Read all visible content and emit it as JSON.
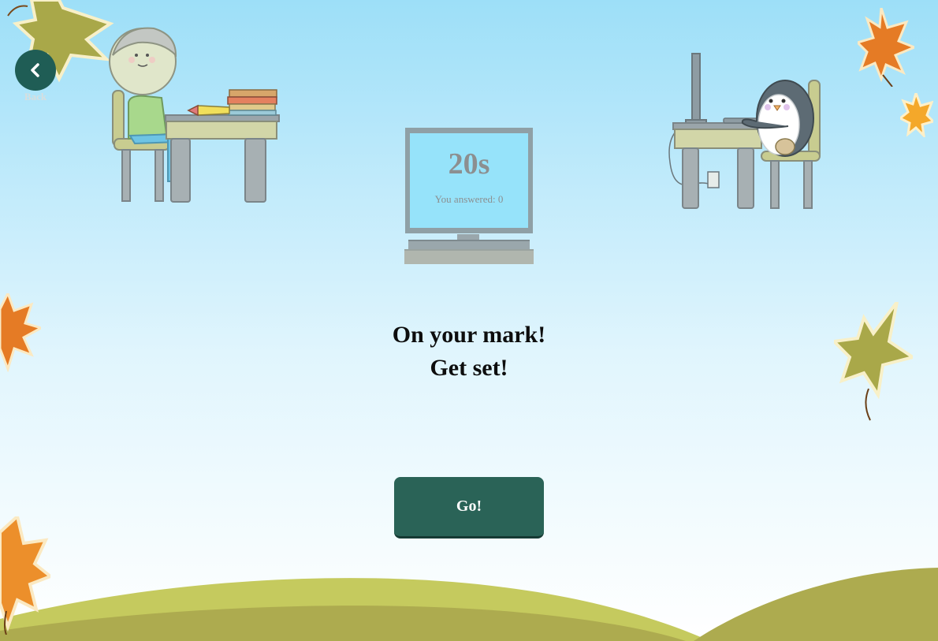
{
  "nav": {
    "back_label": "Back"
  },
  "monitor": {
    "timer": "20s",
    "answered_text": "You answered: 0"
  },
  "heading": {
    "line1": "On your mark!",
    "line2": "Get set!"
  },
  "go_button": {
    "label": "Go!"
  },
  "colors": {
    "sky_top": "#9ddff8",
    "button_green": "#2a6357",
    "hill_light": "#c5ca5e",
    "hill_dark": "#adab4f",
    "leaf_orange": "#e88a2c",
    "leaf_olive": "#a9a849"
  },
  "icons": {
    "back": "chevron-left-icon"
  }
}
